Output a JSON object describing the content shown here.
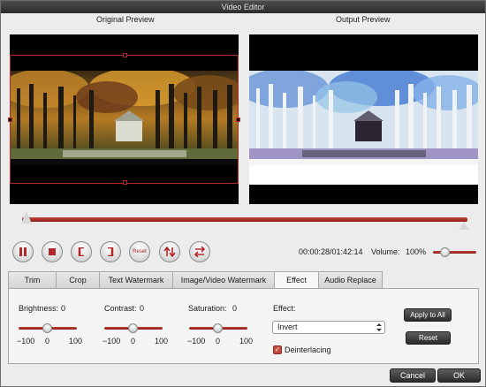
{
  "window": {
    "title": "Video Editor"
  },
  "preview": {
    "original_label": "Original Preview",
    "output_label": "Output Preview"
  },
  "playback": {
    "time": "00:00:28/01:42:14",
    "volume_label": "Volume:",
    "volume_value": "100%",
    "volume_level": 0.22,
    "reset_label": "Reset"
  },
  "tabs": [
    {
      "label": "Trim"
    },
    {
      "label": "Crop"
    },
    {
      "label": "Text Watermark"
    },
    {
      "label": "Image/Video Watermark"
    },
    {
      "label": "Effect",
      "active": true
    },
    {
      "label": "Audio Replace"
    }
  ],
  "effect_panel": {
    "brightness": {
      "label": "Brightness:",
      "value": "0",
      "min": "−100",
      "mid": "0",
      "max": "100"
    },
    "contrast": {
      "label": "Contrast:",
      "value": "0",
      "min": "−100",
      "mid": "0",
      "max": "100"
    },
    "saturation": {
      "label": "Saturation:",
      "value": "0",
      "min": "−100",
      "mid": "0",
      "max": "100"
    },
    "effect_label": "Effect:",
    "effect_selected": "Invert",
    "deinterlacing_label": "Deinterlacing",
    "deinterlacing_checked": true,
    "apply_to_all_label": "Apply to All",
    "reset_label": "Reset"
  },
  "footer": {
    "cancel_label": "Cancel",
    "ok_label": "OK"
  },
  "colors": {
    "accent": "#b0282a",
    "titlebar": "#3a3a3a"
  },
  "icons": [
    "pause-icon",
    "stop-icon",
    "mark-in-icon",
    "mark-out-icon",
    "reset-icon",
    "flip-vertical-icon",
    "flip-horizontal-icon",
    "select-arrows-icon",
    "checkmark-icon"
  ]
}
